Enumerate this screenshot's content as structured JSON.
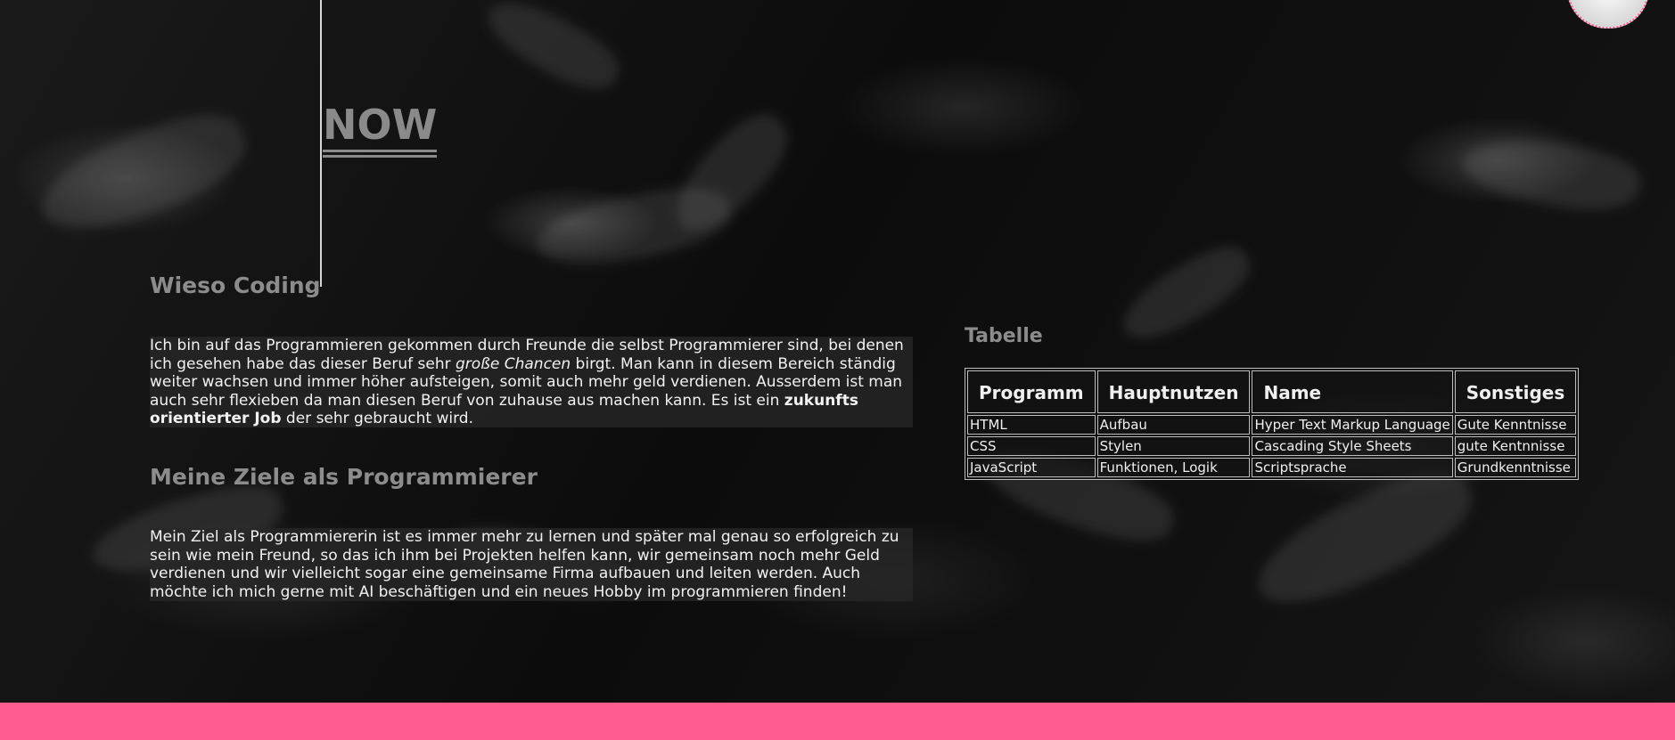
{
  "hero": {
    "title": "NOW"
  },
  "sections": [
    {
      "heading": "Wieso Coding",
      "paragraph": {
        "t1": "Ich bin auf das Programmieren gekommen durch Freunde die selbst Programmierer sind, bei denen ich gesehen habe das dieser Beruf sehr ",
        "em": "große Chancen",
        "t2": " birgt. Man kann in diesem Bereich ständig weiter wachsen und immer höher aufsteigen, somit auch mehr geld verdienen. Ausserdem ist man auch sehr flexieben da man diesen Beruf von zuhause aus machen kann. Es ist ein ",
        "strong": "zukunfts orientierter Job",
        "t3": " der sehr gebraucht wird."
      }
    },
    {
      "heading": "Meine Ziele als Programmierer",
      "paragraph": {
        "text": "Mein Ziel als Programmiererin ist es immer mehr zu lernen und später mal genau so erfolgreich zu sein wie mein Freund, so das ich ihm bei Projekten helfen kann, wir gemeinsam noch mehr Geld verdienen und wir vielleicht sogar eine gemeinsame Firma aufbauen und leiten werden. Auch möchte ich mich gerne mit AI beschäftigen und ein neues Hobby im programmieren finden!"
      }
    }
  ],
  "table": {
    "heading": "Tabelle",
    "headers": [
      "Programm",
      "Hauptnutzen",
      "Name",
      "Sonstiges"
    ],
    "rows": [
      [
        "HTML",
        "Aufbau",
        "Hyper Text Markup Language",
        "Gute Kenntnisse"
      ],
      [
        "CSS",
        "Stylen",
        "Cascading Style Sheets",
        "gute Kentnnisse"
      ],
      [
        "JavaScript",
        "Funktionen, Logik",
        "Scriptsprache",
        "Grundkenntnisse"
      ]
    ]
  },
  "colors": {
    "accent": "#ff5d8f",
    "heading": "#8c8c8c",
    "background": "#0f0f0f"
  },
  "icons": {
    "avatar": "avatar-circle"
  }
}
